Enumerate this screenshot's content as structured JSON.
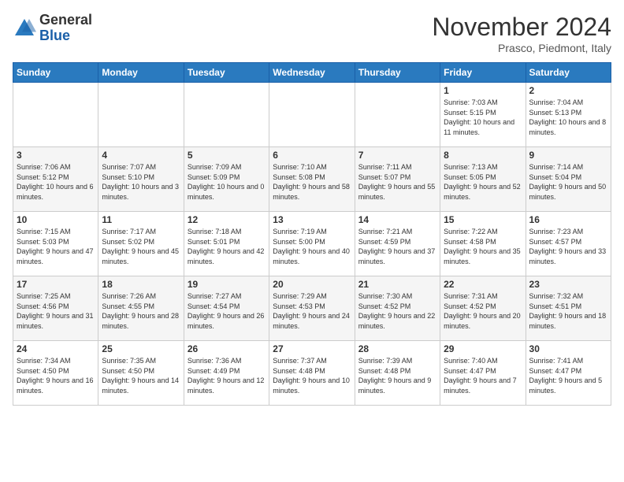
{
  "logo": {
    "general": "General",
    "blue": "Blue"
  },
  "header": {
    "month": "November 2024",
    "location": "Prasco, Piedmont, Italy"
  },
  "weekdays": [
    "Sunday",
    "Monday",
    "Tuesday",
    "Wednesday",
    "Thursday",
    "Friday",
    "Saturday"
  ],
  "weeks": [
    [
      {
        "day": "",
        "info": ""
      },
      {
        "day": "",
        "info": ""
      },
      {
        "day": "",
        "info": ""
      },
      {
        "day": "",
        "info": ""
      },
      {
        "day": "",
        "info": ""
      },
      {
        "day": "1",
        "info": "Sunrise: 7:03 AM\nSunset: 5:15 PM\nDaylight: 10 hours and 11 minutes."
      },
      {
        "day": "2",
        "info": "Sunrise: 7:04 AM\nSunset: 5:13 PM\nDaylight: 10 hours and 8 minutes."
      }
    ],
    [
      {
        "day": "3",
        "info": "Sunrise: 7:06 AM\nSunset: 5:12 PM\nDaylight: 10 hours and 6 minutes."
      },
      {
        "day": "4",
        "info": "Sunrise: 7:07 AM\nSunset: 5:10 PM\nDaylight: 10 hours and 3 minutes."
      },
      {
        "day": "5",
        "info": "Sunrise: 7:09 AM\nSunset: 5:09 PM\nDaylight: 10 hours and 0 minutes."
      },
      {
        "day": "6",
        "info": "Sunrise: 7:10 AM\nSunset: 5:08 PM\nDaylight: 9 hours and 58 minutes."
      },
      {
        "day": "7",
        "info": "Sunrise: 7:11 AM\nSunset: 5:07 PM\nDaylight: 9 hours and 55 minutes."
      },
      {
        "day": "8",
        "info": "Sunrise: 7:13 AM\nSunset: 5:05 PM\nDaylight: 9 hours and 52 minutes."
      },
      {
        "day": "9",
        "info": "Sunrise: 7:14 AM\nSunset: 5:04 PM\nDaylight: 9 hours and 50 minutes."
      }
    ],
    [
      {
        "day": "10",
        "info": "Sunrise: 7:15 AM\nSunset: 5:03 PM\nDaylight: 9 hours and 47 minutes."
      },
      {
        "day": "11",
        "info": "Sunrise: 7:17 AM\nSunset: 5:02 PM\nDaylight: 9 hours and 45 minutes."
      },
      {
        "day": "12",
        "info": "Sunrise: 7:18 AM\nSunset: 5:01 PM\nDaylight: 9 hours and 42 minutes."
      },
      {
        "day": "13",
        "info": "Sunrise: 7:19 AM\nSunset: 5:00 PM\nDaylight: 9 hours and 40 minutes."
      },
      {
        "day": "14",
        "info": "Sunrise: 7:21 AM\nSunset: 4:59 PM\nDaylight: 9 hours and 37 minutes."
      },
      {
        "day": "15",
        "info": "Sunrise: 7:22 AM\nSunset: 4:58 PM\nDaylight: 9 hours and 35 minutes."
      },
      {
        "day": "16",
        "info": "Sunrise: 7:23 AM\nSunset: 4:57 PM\nDaylight: 9 hours and 33 minutes."
      }
    ],
    [
      {
        "day": "17",
        "info": "Sunrise: 7:25 AM\nSunset: 4:56 PM\nDaylight: 9 hours and 31 minutes."
      },
      {
        "day": "18",
        "info": "Sunrise: 7:26 AM\nSunset: 4:55 PM\nDaylight: 9 hours and 28 minutes."
      },
      {
        "day": "19",
        "info": "Sunrise: 7:27 AM\nSunset: 4:54 PM\nDaylight: 9 hours and 26 minutes."
      },
      {
        "day": "20",
        "info": "Sunrise: 7:29 AM\nSunset: 4:53 PM\nDaylight: 9 hours and 24 minutes."
      },
      {
        "day": "21",
        "info": "Sunrise: 7:30 AM\nSunset: 4:52 PM\nDaylight: 9 hours and 22 minutes."
      },
      {
        "day": "22",
        "info": "Sunrise: 7:31 AM\nSunset: 4:52 PM\nDaylight: 9 hours and 20 minutes."
      },
      {
        "day": "23",
        "info": "Sunrise: 7:32 AM\nSunset: 4:51 PM\nDaylight: 9 hours and 18 minutes."
      }
    ],
    [
      {
        "day": "24",
        "info": "Sunrise: 7:34 AM\nSunset: 4:50 PM\nDaylight: 9 hours and 16 minutes."
      },
      {
        "day": "25",
        "info": "Sunrise: 7:35 AM\nSunset: 4:50 PM\nDaylight: 9 hours and 14 minutes."
      },
      {
        "day": "26",
        "info": "Sunrise: 7:36 AM\nSunset: 4:49 PM\nDaylight: 9 hours and 12 minutes."
      },
      {
        "day": "27",
        "info": "Sunrise: 7:37 AM\nSunset: 4:48 PM\nDaylight: 9 hours and 10 minutes."
      },
      {
        "day": "28",
        "info": "Sunrise: 7:39 AM\nSunset: 4:48 PM\nDaylight: 9 hours and 9 minutes."
      },
      {
        "day": "29",
        "info": "Sunrise: 7:40 AM\nSunset: 4:47 PM\nDaylight: 9 hours and 7 minutes."
      },
      {
        "day": "30",
        "info": "Sunrise: 7:41 AM\nSunset: 4:47 PM\nDaylight: 9 hours and 5 minutes."
      }
    ]
  ]
}
